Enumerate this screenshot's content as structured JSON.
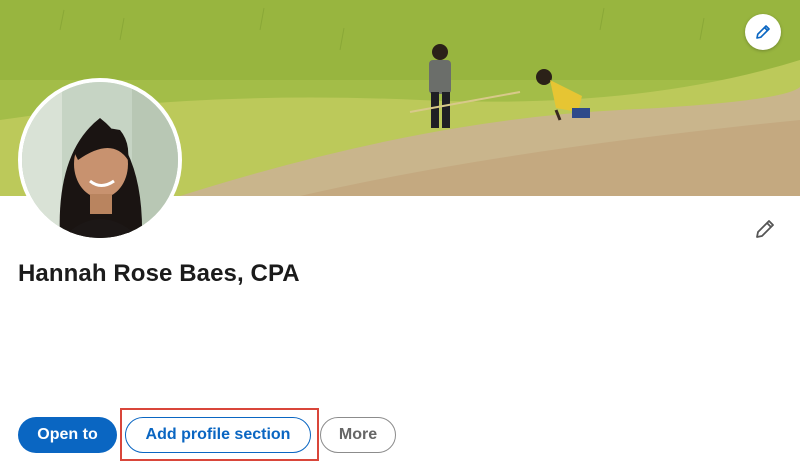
{
  "profile": {
    "name": "Hannah Rose Baes, CPA",
    "cover_edit_icon": "pencil-icon",
    "intro_edit_icon": "pencil-icon"
  },
  "actions": {
    "open_to_label": "Open to",
    "add_section_label": "Add profile section",
    "more_label": "More"
  },
  "colors": {
    "accent": "#0a66c2",
    "highlight": "#d9463a"
  }
}
